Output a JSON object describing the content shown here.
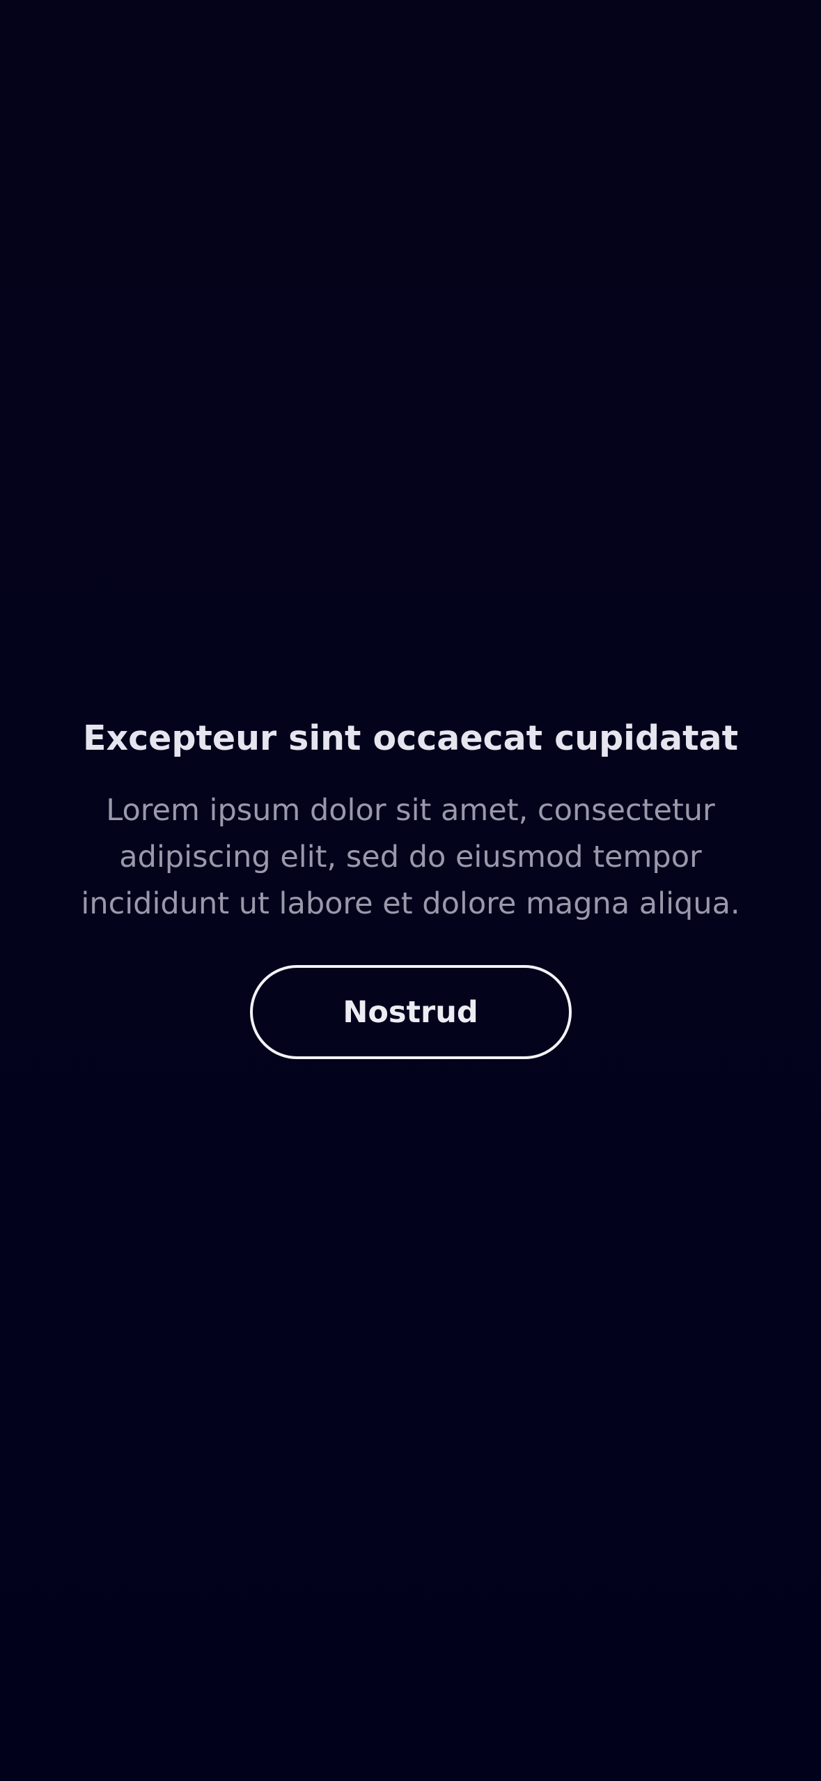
{
  "empty_state": {
    "title": "Excepteur sint occaecat cupidatat",
    "message": "Lorem ipsum dolor sit amet, consectetur adipiscing elit, sed do eiusmod tempor incididunt ut labore et dolore magna aliqua.",
    "button_label": "Nostrud"
  },
  "colors": {
    "background": "#03031a",
    "title": "#e6e5ef",
    "message": "#9a99aa",
    "button_border": "#f3f3f7"
  }
}
